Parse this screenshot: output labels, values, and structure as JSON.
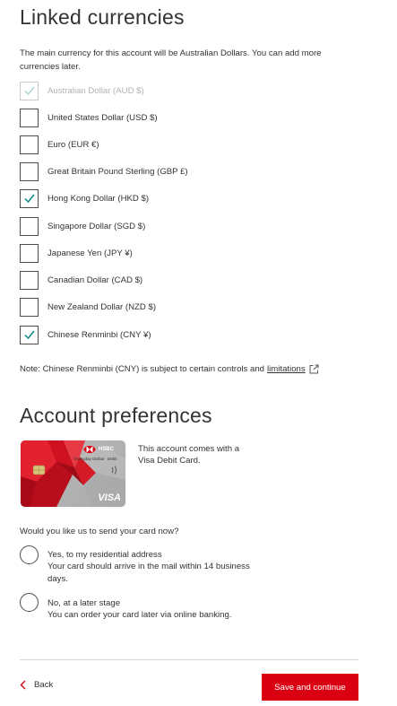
{
  "linked_currencies": {
    "heading": "Linked currencies",
    "intro": "The main currency for this account will be Australian Dollars. You can add more currencies later.",
    "options": [
      {
        "label": "Australian Dollar (AUD $)",
        "checked": true,
        "disabled": true
      },
      {
        "label": "United States Dollar (USD $)",
        "checked": false,
        "disabled": false
      },
      {
        "label": "Euro (EUR €)",
        "checked": false,
        "disabled": false
      },
      {
        "label": "Great Britain Pound Sterling (GBP £)",
        "checked": false,
        "disabled": false
      },
      {
        "label": "Hong Kong Dollar (HKD $)",
        "checked": true,
        "disabled": false
      },
      {
        "label": "Singapore Dollar (SGD $)",
        "checked": false,
        "disabled": false
      },
      {
        "label": "Japanese Yen (JPY ¥)",
        "checked": false,
        "disabled": false
      },
      {
        "label": "Canadian Dollar (CAD $)",
        "checked": false,
        "disabled": false
      },
      {
        "label": "New Zealand Dollar (NZD $)",
        "checked": false,
        "disabled": false
      },
      {
        "label": "Chinese Renminbi (CNY ¥)",
        "checked": true,
        "disabled": false
      }
    ],
    "note_text": "Note: Chinese Renminbi (CNY) is subject to certain controls and",
    "note_link": "limitations",
    "note_link_icon": "external-link-icon"
  },
  "account_preferences": {
    "heading": "Account preferences",
    "card": {
      "brand": "HSBC",
      "product": "Everyday Global · Debit",
      "network": "VISA"
    },
    "card_description": "This account comes with a Visa Debit Card.",
    "question": "Would you like us to send your card now?",
    "radios": [
      {
        "title": "Yes, to my residential address",
        "subtitle": "Your card should arrive in the mail within 14 business days.",
        "selected": false
      },
      {
        "title": "No, at a later stage",
        "subtitle": "You can order your card later via online banking.",
        "selected": false
      }
    ]
  },
  "footer": {
    "back_label": "Back",
    "back_icon": "chevron-left-icon",
    "continue_label": "Save and continue"
  },
  "colors": {
    "primary_red": "#db0011",
    "checkmark_teal": "#00847f",
    "checkmark_disabled": "#a6d5d2"
  }
}
